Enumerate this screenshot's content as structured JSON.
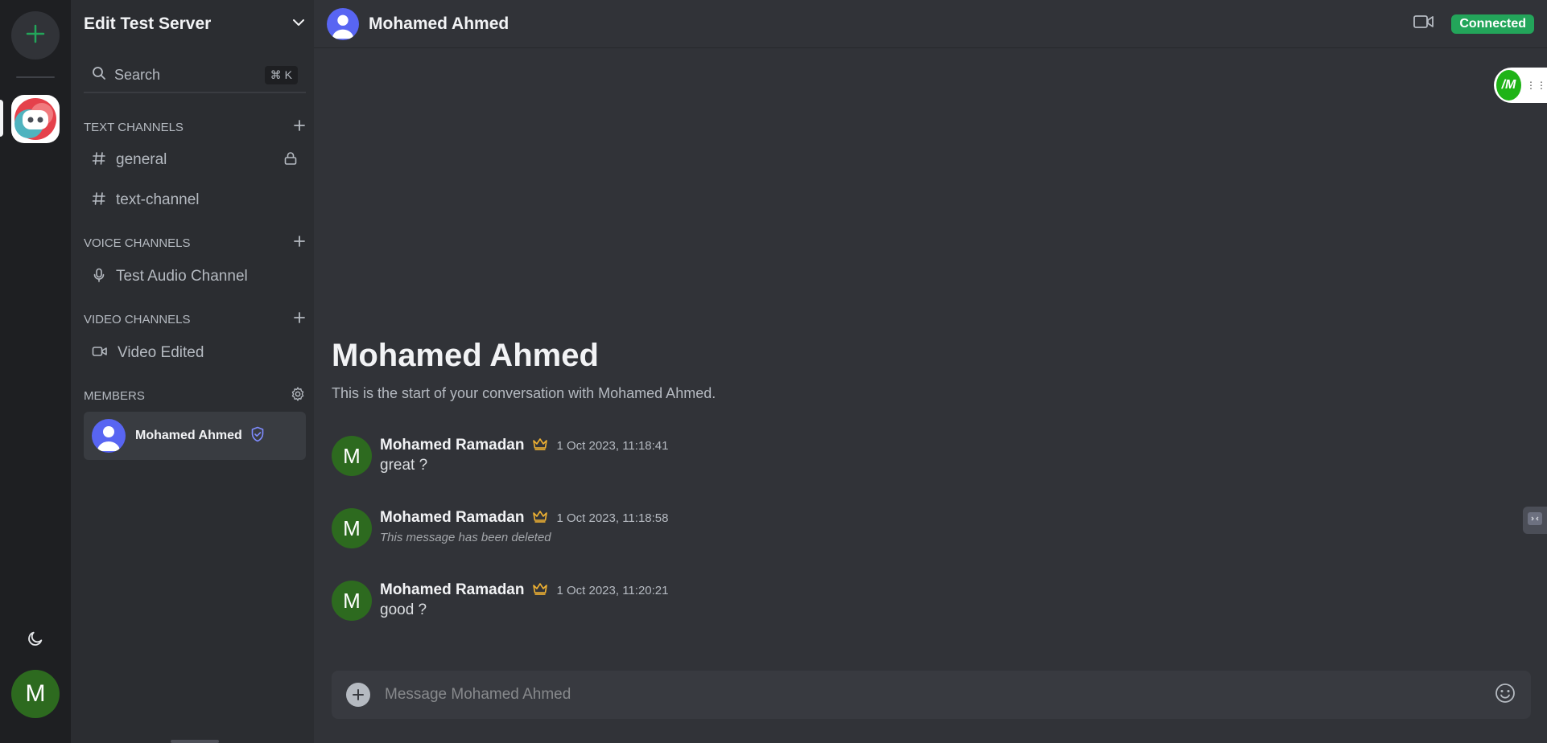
{
  "colors": {
    "rail_bg": "#1e1f22",
    "sidebar_bg": "#2b2d31",
    "main_bg": "#313338",
    "accent": "#5865f2",
    "connected": "#23a55a",
    "crown": "#f0b232",
    "add_green": "#23a55a",
    "avatar_green": "#2d6a1f"
  },
  "rail": {
    "add_icon": "plus-icon",
    "server_icon": "discord-logo",
    "theme_icon": "moon-icon",
    "user_avatar_letter": "M"
  },
  "sidebar": {
    "server_name": "Edit Test Server",
    "search": {
      "label": "Search",
      "shortcut": "⌘ K"
    },
    "sections": [
      {
        "title": "TEXT CHANNELS",
        "channels": [
          {
            "name": "general",
            "icon": "hash-icon",
            "locked": true
          },
          {
            "name": "text-channel",
            "icon": "hash-icon",
            "locked": false
          }
        ]
      },
      {
        "title": "VOICE CHANNELS",
        "channels": [
          {
            "name": "Test Audio Channel",
            "icon": "mic-icon"
          }
        ]
      },
      {
        "title": "VIDEO CHANNELS",
        "channels": [
          {
            "name": "Video Edited",
            "icon": "video-icon"
          }
        ]
      }
    ],
    "members_title": "MEMBERS",
    "members": [
      {
        "name": "Mohamed Ahmed",
        "badge": "shield-check-icon"
      }
    ]
  },
  "header": {
    "title": "Mohamed Ahmed",
    "status": "Connected"
  },
  "floating_logo": {
    "text": "/M"
  },
  "welcome": {
    "title": "Mohamed Ahmed",
    "subtitle": "This is the start of your conversation with Mohamed Ahmed."
  },
  "messages": [
    {
      "author": "Mohamed Ramadan",
      "avatar": "M",
      "time": "1 Oct 2023, 11:18:41",
      "text": "great ?",
      "deleted": false
    },
    {
      "author": "Mohamed Ramadan",
      "avatar": "M",
      "time": "1 Oct 2023, 11:18:58",
      "text": "This message has been deleted",
      "deleted": true
    },
    {
      "author": "Mohamed Ramadan",
      "avatar": "M",
      "time": "1 Oct 2023, 11:20:21",
      "text": "good ?",
      "deleted": false
    }
  ],
  "composer": {
    "placeholder": "Message Mohamed Ahmed"
  }
}
